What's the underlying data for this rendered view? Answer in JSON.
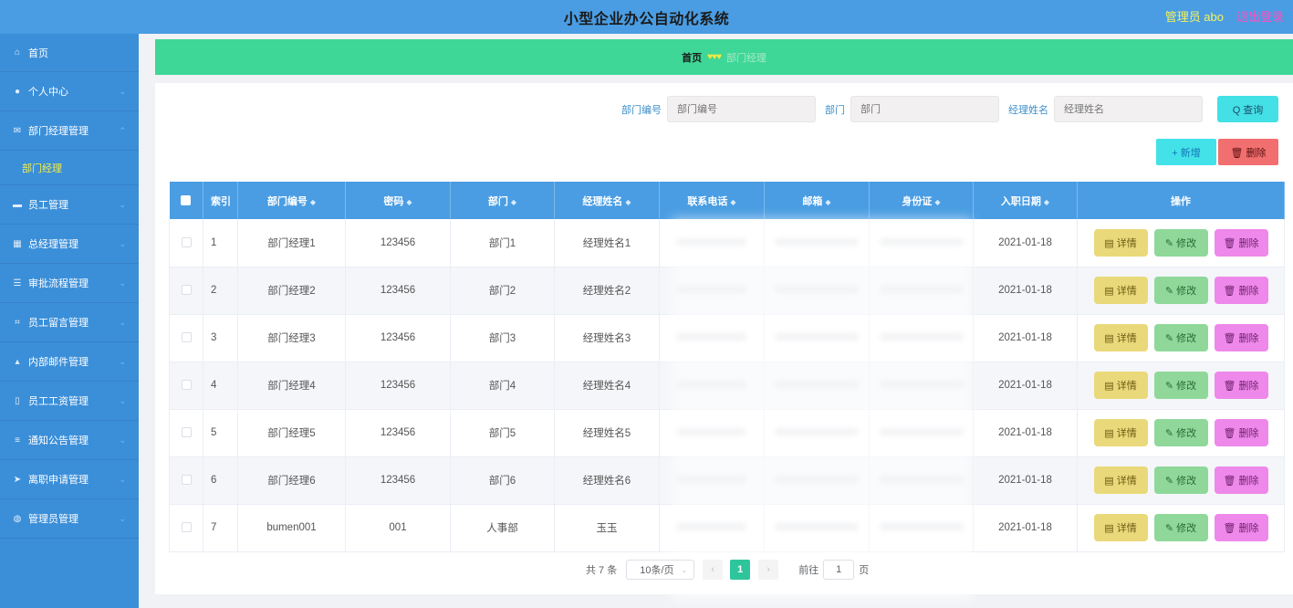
{
  "header": {
    "title": "小型企业办公自动化系统",
    "user": "管理员 abo",
    "logout": "退出登录"
  },
  "sidebar": {
    "items": [
      {
        "label": "首页",
        "icon": "home-icon",
        "glyph": "⌂",
        "arrow": ""
      },
      {
        "label": "个人中心",
        "icon": "user-icon",
        "glyph": "●",
        "arrow": "⌄"
      },
      {
        "label": "部门经理管理",
        "icon": "mail-icon",
        "glyph": "✉",
        "arrow": "⌃"
      },
      {
        "label": "部门经理",
        "sub": true
      },
      {
        "label": "员工管理",
        "icon": "chat-icon",
        "glyph": "▬",
        "arrow": "⌄"
      },
      {
        "label": "总经理管理",
        "icon": "card-icon",
        "glyph": "▦",
        "arrow": "⌄"
      },
      {
        "label": "审批流程管理",
        "icon": "list-icon",
        "glyph": "☰",
        "arrow": "⌄"
      },
      {
        "label": "员工留言管理",
        "icon": "crop-icon",
        "glyph": "⌗",
        "arrow": "⌄"
      },
      {
        "label": "内部邮件管理",
        "icon": "thumb-icon",
        "glyph": "▴",
        "arrow": "⌄"
      },
      {
        "label": "员工工资管理",
        "icon": "phone-icon",
        "glyph": "▯",
        "arrow": "⌄"
      },
      {
        "label": "通知公告管理",
        "icon": "menu-icon",
        "glyph": "≡",
        "arrow": "⌄"
      },
      {
        "label": "离职申请管理",
        "icon": "send-icon",
        "glyph": "➤",
        "arrow": "⌄"
      },
      {
        "label": "管理员管理",
        "icon": "globe-icon",
        "glyph": "◍",
        "arrow": "⌄"
      }
    ]
  },
  "breadcrumb": {
    "home": "首页",
    "separator": "♥♥♥",
    "current": "部门经理"
  },
  "search": {
    "fields": [
      {
        "label": "部门编号",
        "placeholder": "部门编号"
      },
      {
        "label": "部门",
        "placeholder": "部门"
      },
      {
        "label": "经理姓名",
        "placeholder": "经理姓名"
      }
    ],
    "query_label": "Q 查询"
  },
  "actions": {
    "add_label": "+ 新增",
    "delete_label": "🗑 删除"
  },
  "table": {
    "columns": [
      "索引",
      "部门编号",
      "密码",
      "部门",
      "经理姓名",
      "联系电话",
      "邮箱",
      "身份证",
      "入职日期",
      "操作"
    ],
    "sort_glyph": "◆",
    "rows": [
      {
        "index": "1",
        "code": "部门经理1",
        "password": "123456",
        "dept": "部门1",
        "name": "经理姓名1",
        "date": "2021-01-18"
      },
      {
        "index": "2",
        "code": "部门经理2",
        "password": "123456",
        "dept": "部门2",
        "name": "经理姓名2",
        "date": "2021-01-18"
      },
      {
        "index": "3",
        "code": "部门经理3",
        "password": "123456",
        "dept": "部门3",
        "name": "经理姓名3",
        "date": "2021-01-18"
      },
      {
        "index": "4",
        "code": "部门经理4",
        "password": "123456",
        "dept": "部门4",
        "name": "经理姓名4",
        "date": "2021-01-18"
      },
      {
        "index": "5",
        "code": "部门经理5",
        "password": "123456",
        "dept": "部门5",
        "name": "经理姓名5",
        "date": "2021-01-18"
      },
      {
        "index": "6",
        "code": "部门经理6",
        "password": "123456",
        "dept": "部门6",
        "name": "经理姓名6",
        "date": "2021-01-18"
      },
      {
        "index": "7",
        "code": "bumen001",
        "password": "001",
        "dept": "人事部",
        "name": "玉玉",
        "date": "2021-01-18"
      }
    ],
    "row_buttons": {
      "view": "▤ 详情",
      "edit": "✎ 修改",
      "remove": "🗑 删除"
    }
  },
  "pagination": {
    "total": "共 7 条",
    "page_size": "10条/页",
    "prev": "‹",
    "current": "1",
    "next": "›",
    "goto_prefix": "前往",
    "goto_value": "1",
    "goto_suffix": "页"
  },
  "colors": {
    "header": "#4a9de3",
    "sidebar": "#3b8fd9",
    "breadcrumb": "#3ed797",
    "accent": "#2fc59a"
  }
}
